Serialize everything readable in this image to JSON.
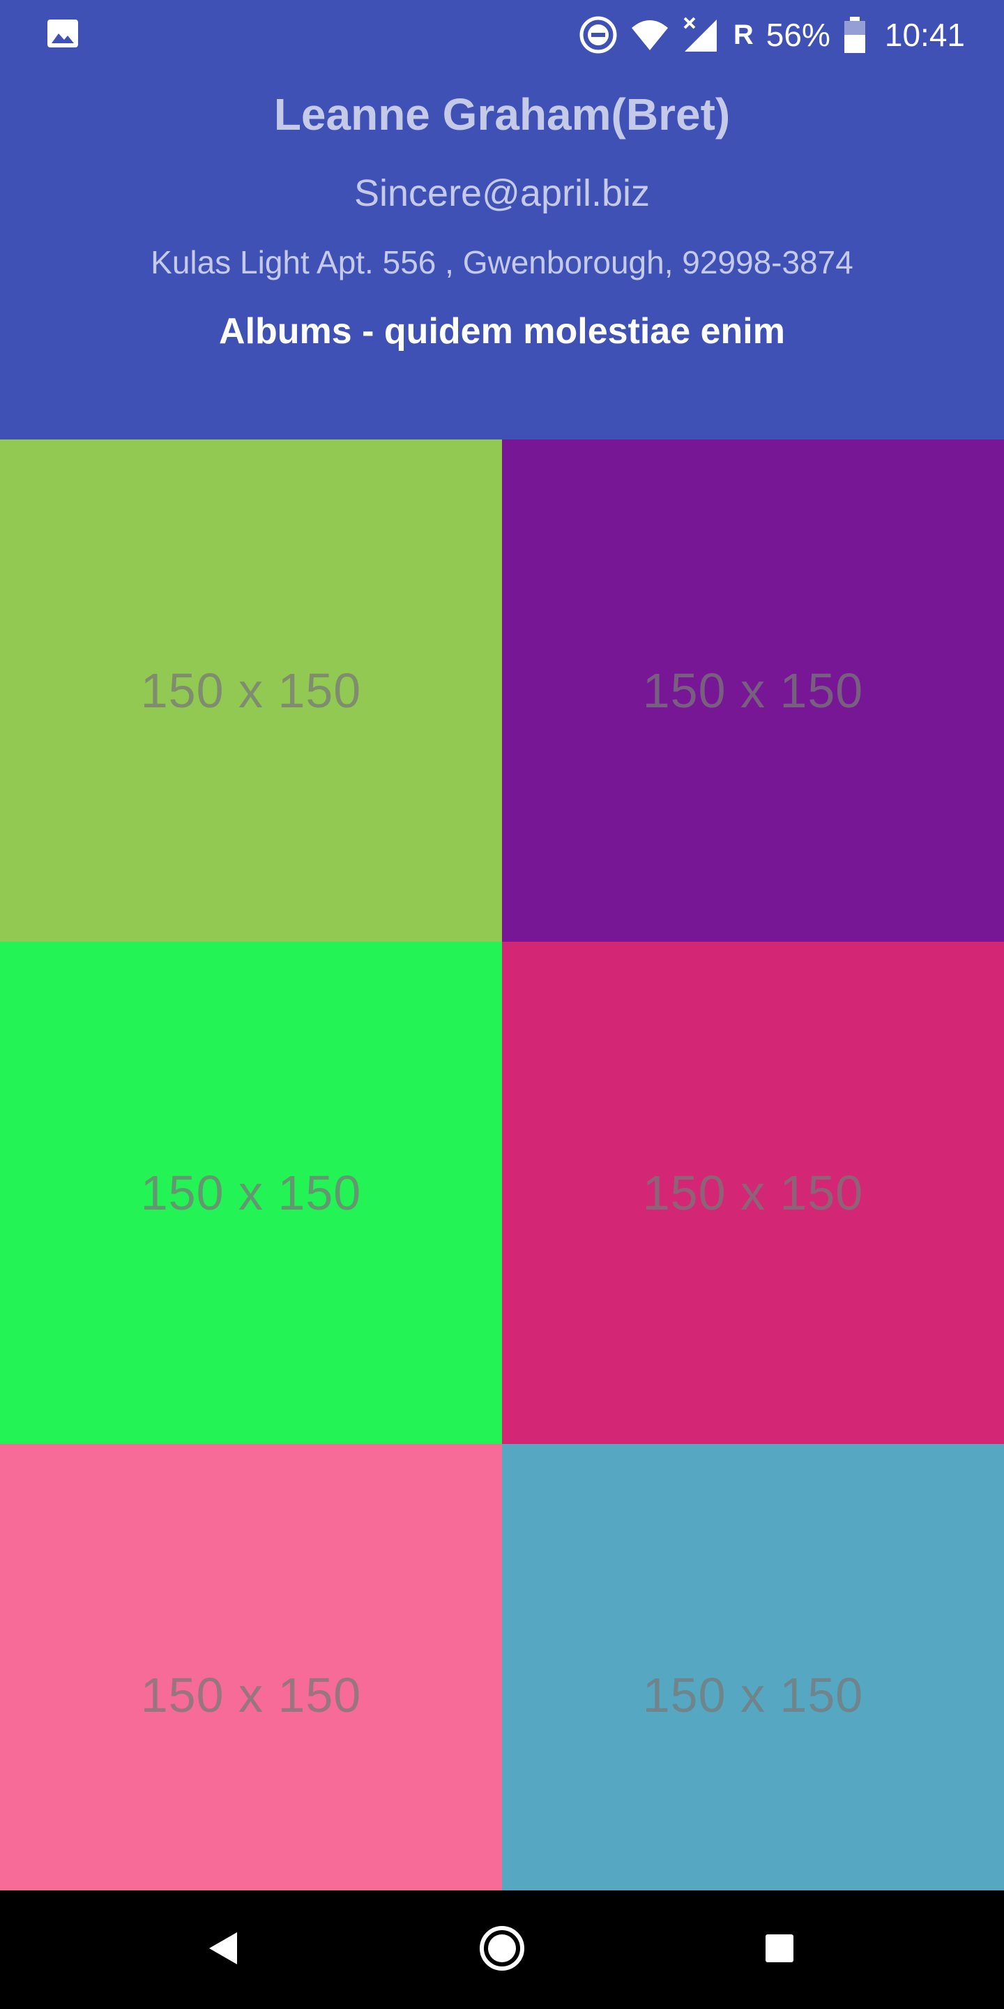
{
  "status_bar": {
    "left_icon": "image-icon",
    "icons": [
      "do-not-disturb-icon",
      "wifi-icon",
      "cellular-signal-icon"
    ],
    "roaming": "R",
    "battery_percent": "56%",
    "battery_icon": "battery-icon",
    "time": "10:41"
  },
  "profile": {
    "name": "Leanne Graham(Bret)",
    "email": "Sincere@april.biz",
    "address": "Kulas Light Apt. 556 , Gwenborough, 92998-3874"
  },
  "album": {
    "title": "Albums - quidem molestiae enim"
  },
  "photos": [
    {
      "label": "150 x 150",
      "color": "#92C952"
    },
    {
      "label": "150 x 150",
      "color": "#771796"
    },
    {
      "label": "150 x 150",
      "color": "#24F355"
    },
    {
      "label": "150 x 150",
      "color": "#D32776"
    },
    {
      "label": "150 x 150",
      "color": "#F66B97"
    },
    {
      "label": "150 x 150",
      "color": "#56A8C2"
    }
  ],
  "colors": {
    "header_background": "#3F51B5",
    "header_text_muted": "#C5CAE9",
    "header_text": "#FFFFFF",
    "nav_background": "#000000"
  },
  "nav_bar": {
    "back_icon": "back-triangle-icon",
    "home_icon": "home-circle-icon",
    "recents_icon": "recents-square-icon"
  }
}
